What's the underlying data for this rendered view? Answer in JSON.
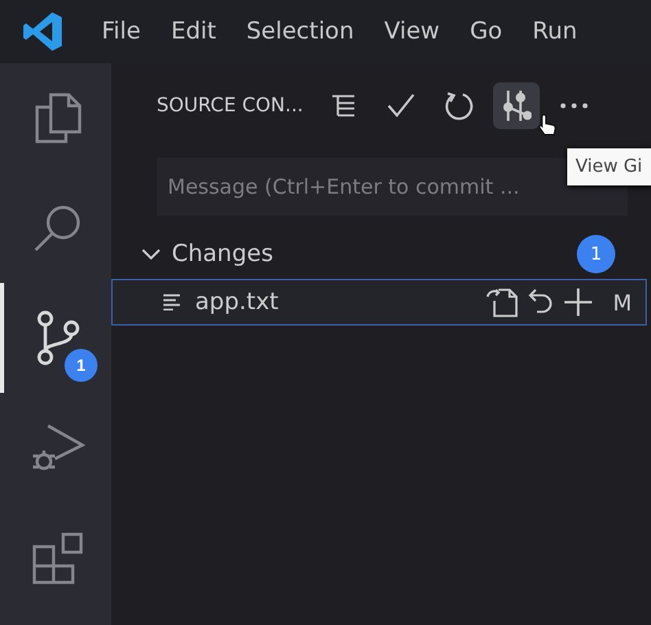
{
  "menu": [
    "File",
    "Edit",
    "Selection",
    "View",
    "Go",
    "Run"
  ],
  "activity_bar": [
    {
      "kind": "files",
      "selected": false
    },
    {
      "kind": "search",
      "selected": false
    },
    {
      "kind": "source-control",
      "selected": true,
      "badge": "1"
    },
    {
      "kind": "run-debug",
      "selected": false
    },
    {
      "kind": "extensions",
      "selected": false
    }
  ],
  "sidebar": {
    "title": "SOURCE CON...",
    "actions": [
      {
        "kind": "tree",
        "hovered": false
      },
      {
        "kind": "commit",
        "hovered": false
      },
      {
        "kind": "refresh",
        "hovered": false
      },
      {
        "kind": "graph",
        "hovered": true
      },
      {
        "kind": "more",
        "hovered": false
      }
    ],
    "tooltip": "View Gi",
    "message": {
      "placeholder": "Message (Ctrl+Enter to commit ..."
    },
    "changes": {
      "label": "Changes",
      "expanded": true,
      "count": "1",
      "files": [
        {
          "name": "app.txt",
          "status": "M",
          "selected": true
        }
      ]
    }
  }
}
